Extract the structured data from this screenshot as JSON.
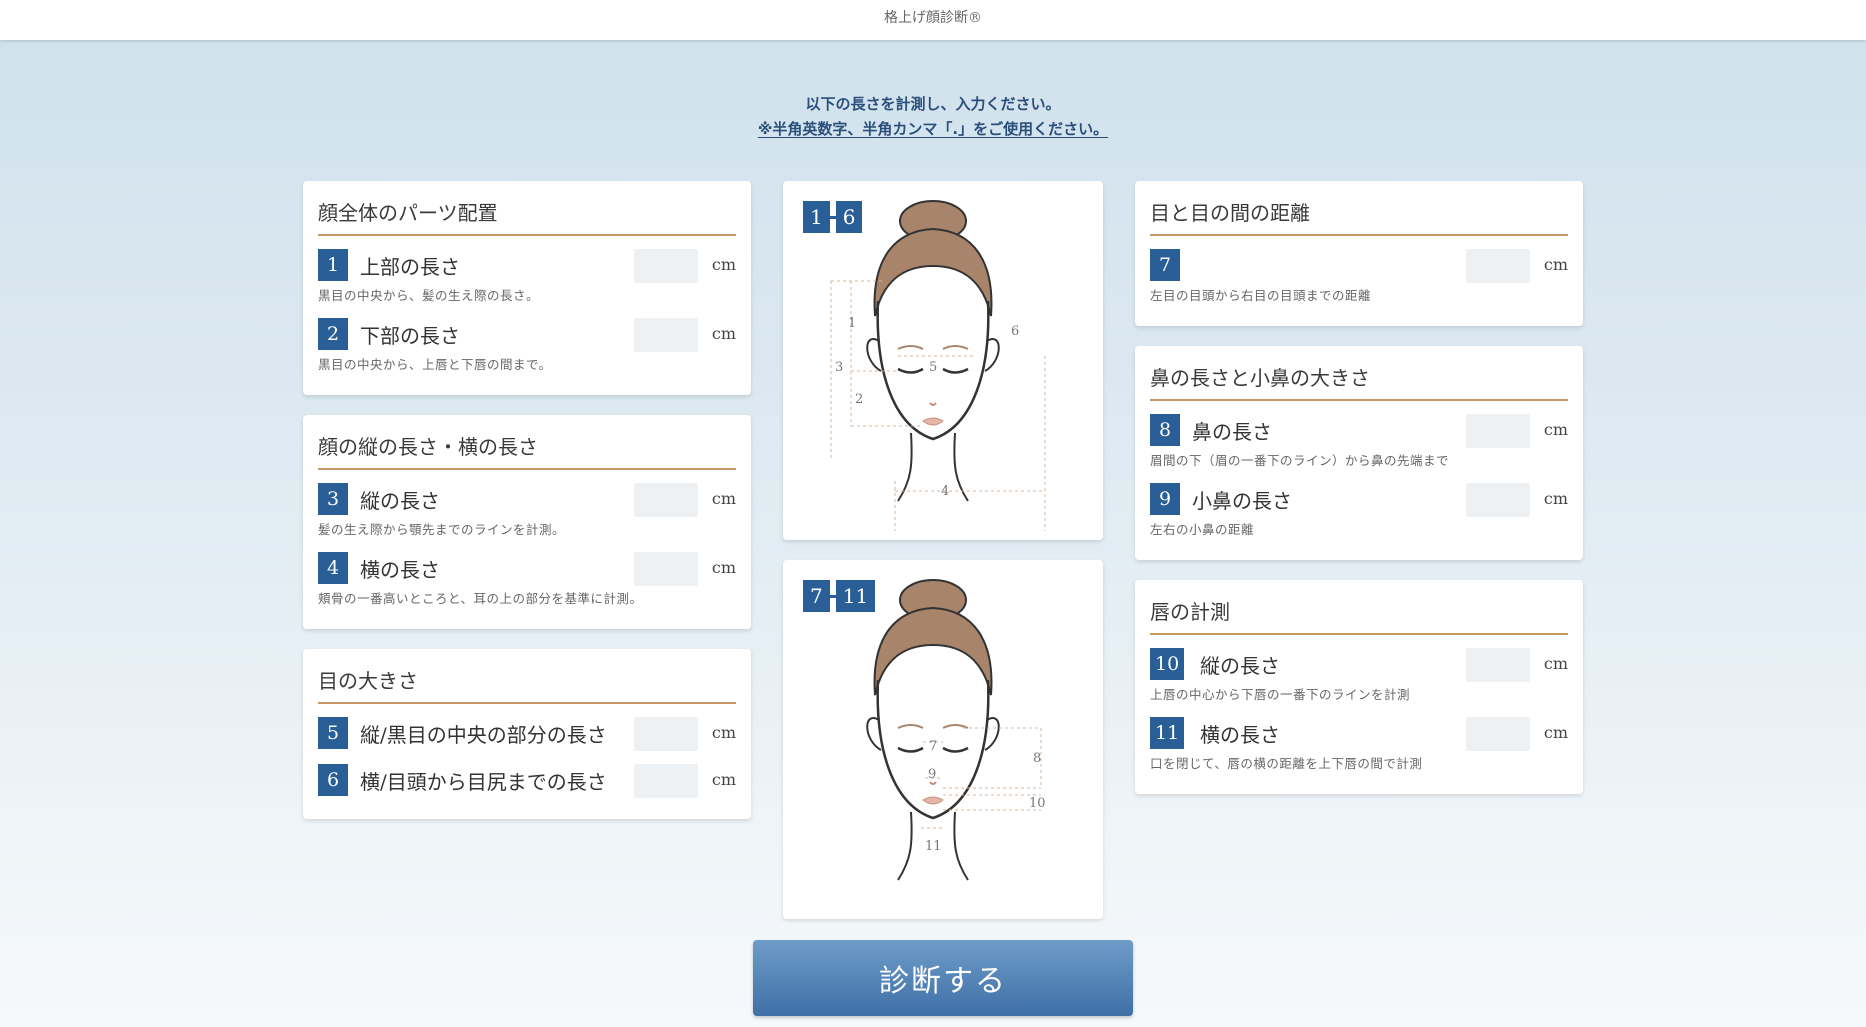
{
  "header": {
    "title": "格上げ顔診断®"
  },
  "intro": {
    "line1": "以下の長さを計測し、入力ください。",
    "line2": "※半角英数字、半角カンマ「.」をご使用ください。"
  },
  "unit": "cm",
  "sections": {
    "face_parts": {
      "title": "顔全体のパーツ配置",
      "items": [
        {
          "num": "1",
          "label": "上部の長さ",
          "desc": "黒目の中央から、髪の生え際の長さ。",
          "value": ""
        },
        {
          "num": "2",
          "label": "下部の長さ",
          "desc": "黒目の中央から、上唇と下唇の間まで。",
          "value": ""
        }
      ]
    },
    "face_size": {
      "title": "顔の縦の長さ・横の長さ",
      "items": [
        {
          "num": "3",
          "label": "縦の長さ",
          "desc": "髪の生え際から顎先までのラインを計測。",
          "value": ""
        },
        {
          "num": "4",
          "label": "横の長さ",
          "desc": "頬骨の一番高いところと、耳の上の部分を基準に計測。",
          "value": ""
        }
      ]
    },
    "eye_size": {
      "title": "目の大きさ",
      "items": [
        {
          "num": "5",
          "label": "縦/黒目の中央の部分の長さ",
          "value": ""
        },
        {
          "num": "6",
          "label": "横/目頭から目尻までの長さ",
          "value": ""
        }
      ]
    },
    "eye_distance": {
      "title": "目と目の間の距離",
      "items": [
        {
          "num": "7",
          "label": "",
          "desc": "左目の目頭から右目の目頭までの距離",
          "value": ""
        }
      ]
    },
    "nose": {
      "title": "鼻の長さと小鼻の大きさ",
      "items": [
        {
          "num": "8",
          "label": "鼻の長さ",
          "desc": "眉間の下（眉の一番下のライン）から鼻の先端まで",
          "value": ""
        },
        {
          "num": "9",
          "label": "小鼻の長さ",
          "desc": "左右の小鼻の距離",
          "value": ""
        }
      ]
    },
    "lips": {
      "title": "唇の計測",
      "items": [
        {
          "num": "10",
          "label": "縦の長さ",
          "desc": "上唇の中心から下唇の一番下のラインを計測",
          "value": ""
        },
        {
          "num": "11",
          "label": "横の長さ",
          "desc": "口を閉じて、唇の横の距離を上下唇の間で計測",
          "value": ""
        }
      ]
    }
  },
  "illustrations": {
    "top": {
      "from": "1",
      "to": "6",
      "marks": [
        "1",
        "2",
        "3",
        "4",
        "5",
        "6"
      ]
    },
    "bottom": {
      "from": "7",
      "to": "11",
      "marks": [
        "7",
        "8",
        "9",
        "10",
        "11"
      ]
    }
  },
  "submit": {
    "label": "診断する"
  },
  "colors": {
    "accent": "#2a5e97",
    "rule": "#c49a62",
    "hair": "#a8856a"
  }
}
